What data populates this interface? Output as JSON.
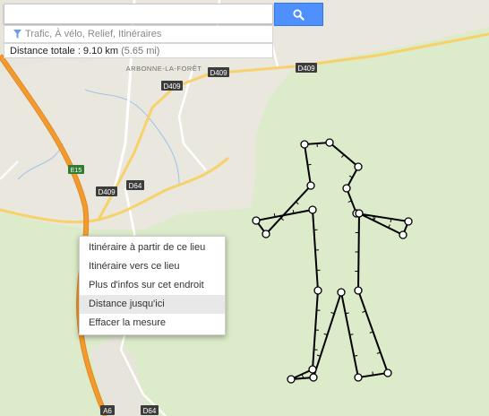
{
  "search": {
    "value": "",
    "placeholder": ""
  },
  "layers_link": "Trafic, À vélo, Relief, Itinéraires",
  "distance": {
    "label": "Distance totale : 9.10 km",
    "imperial": "(5.65 mi)"
  },
  "context_menu": [
    {
      "label": "Itinéraire à partir de ce lieu"
    },
    {
      "label": "Itinéraire vers ce lieu"
    },
    {
      "label": "Plus d'infos sur cet endroit"
    },
    {
      "label": "Distance jusqu'ici"
    },
    {
      "label": "Effacer la mesure"
    }
  ],
  "map_labels": {
    "town": "ARBONNE-LA-FORÊT",
    "road_d409_a": "D409",
    "road_d409_b": "D409",
    "road_d409_c": "D409",
    "road_d409_d": "D409",
    "road_d64_a": "D64",
    "road_d64_b": "D64",
    "road_e15": "E15",
    "road_a6": "A6"
  },
  "colors": {
    "forest": "#dcebc9",
    "town": "#eae7df",
    "motorway": "#f29a2e",
    "road": "#f7d26a",
    "search_button": "#4d90fe"
  },
  "icons": {
    "search": "search-icon",
    "layers": "filter-icon"
  }
}
